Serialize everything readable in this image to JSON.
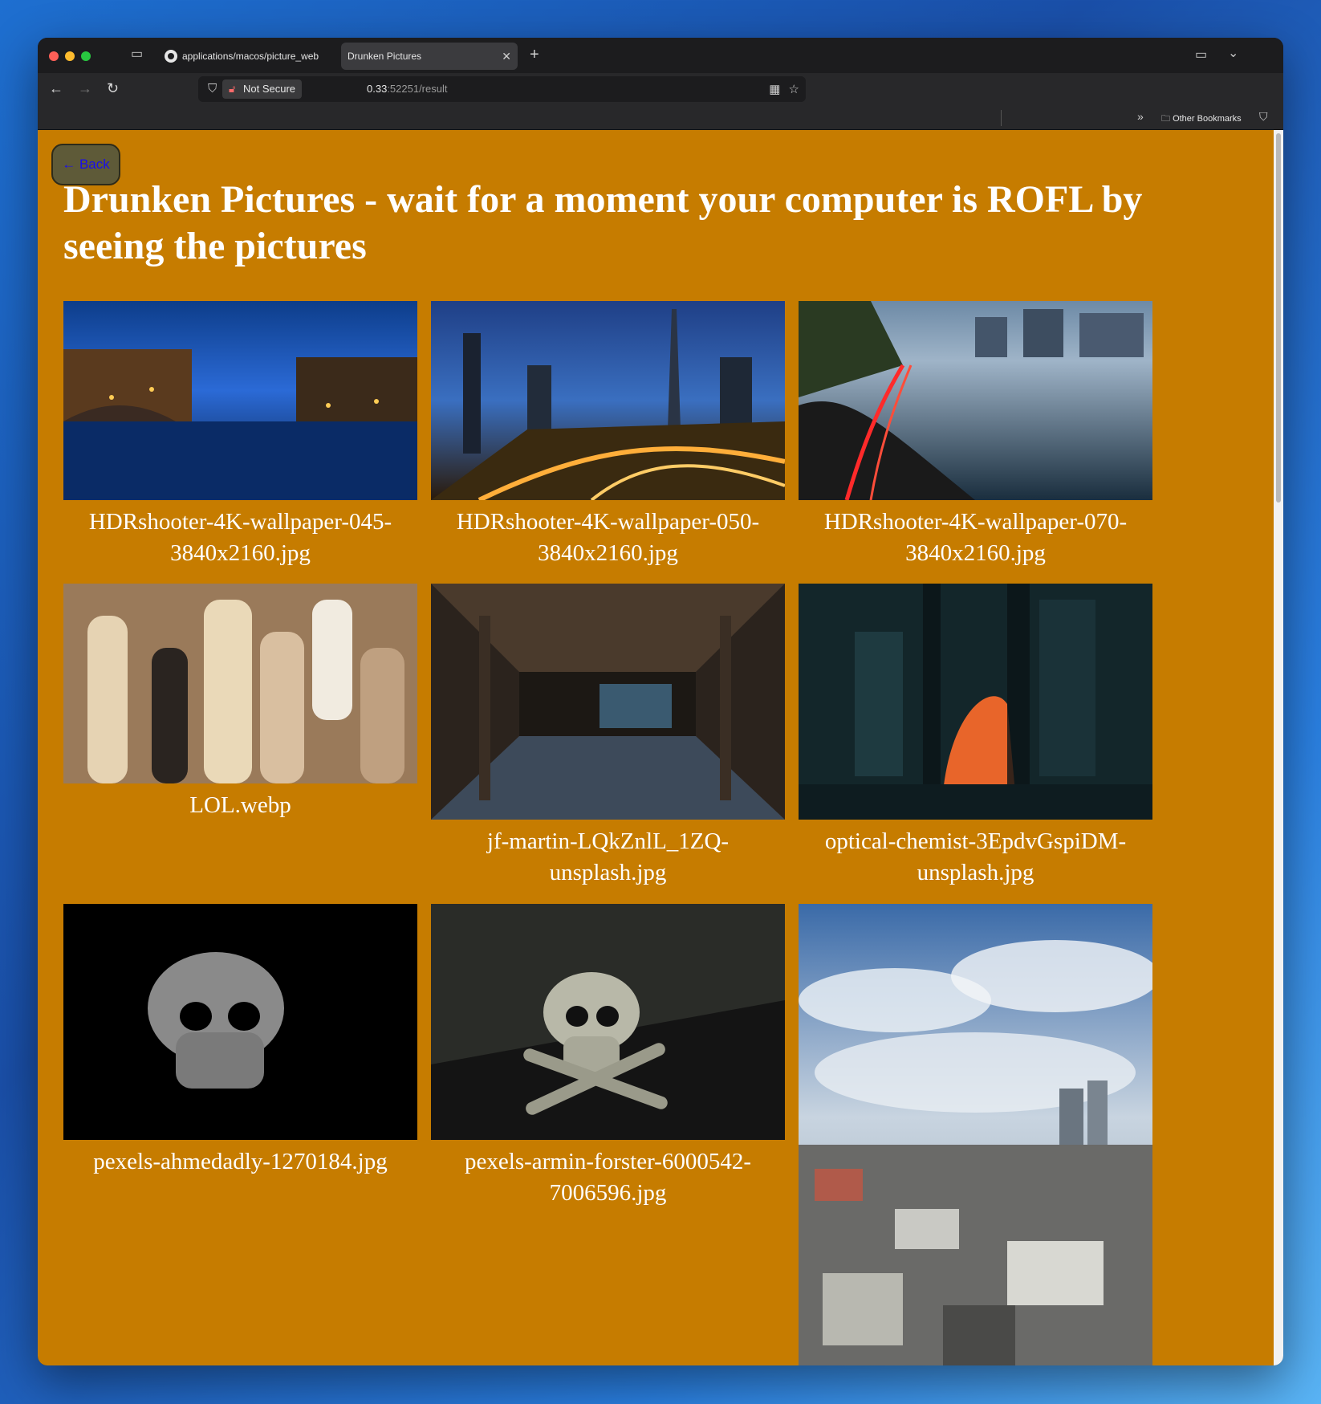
{
  "browser": {
    "tabs": [
      {
        "label": "applications/macos/picture_web",
        "active": false
      },
      {
        "label": "Drunken Pictures",
        "active": true
      }
    ],
    "security_label": "Not Secure",
    "url_prefix": "0.33",
    "url_rest": ":52251/result",
    "bookmarks_more": "»",
    "other_bookmarks": "Other Bookmarks"
  },
  "page": {
    "back_label": "← Back",
    "title": "Drunken Pictures - wait for a moment your computer is ROFL by seeing the pictures",
    "background_color": "#c67c00",
    "images": [
      {
        "caption": "HDRshooter-4K-wallpaper-045-3840x2160.jpg"
      },
      {
        "caption": "HDRshooter-4K-wallpaper-050-3840x2160.jpg"
      },
      {
        "caption": "HDRshooter-4K-wallpaper-070-3840x2160.jpg"
      },
      {
        "caption": "LOL.webp"
      },
      {
        "caption": "jf-martin-LQkZnlL_1ZQ-unsplash.jpg"
      },
      {
        "caption": "optical-chemist-3EpdvGspiDM-unsplash.jpg"
      },
      {
        "caption": "pexels-ahmedadly-1270184.jpg"
      },
      {
        "caption": "pexels-armin-forster-6000542-7006596.jpg"
      },
      {
        "caption": ""
      }
    ]
  }
}
